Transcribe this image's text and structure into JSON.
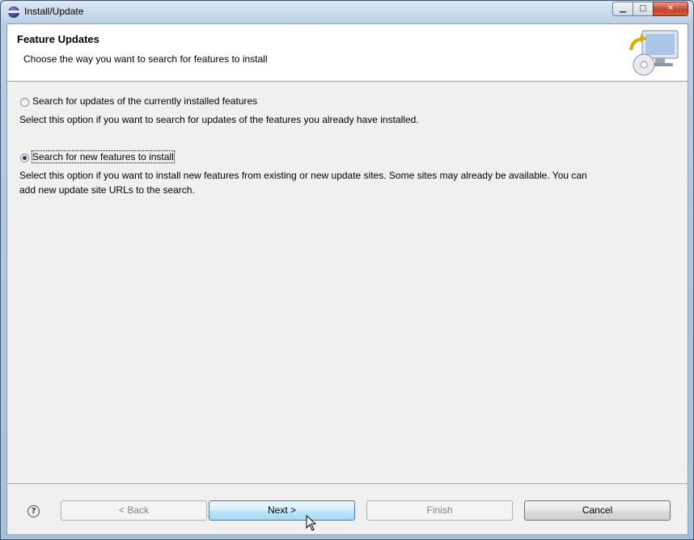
{
  "window": {
    "title": "Install/Update"
  },
  "header": {
    "title": "Feature Updates",
    "subtitle": "Choose the way you want to search for features to install"
  },
  "options": [
    {
      "label": "Search for updates of the currently installed features",
      "checked": false,
      "description": "Select this option if you want to search for updates of the features you already have installed."
    },
    {
      "label": "Search for new features to install",
      "checked": true,
      "description_line1": "Select this option if you want to install new features from existing or new update sites. Some sites may already be available. You can",
      "description_line2": "add new update site URLs to the search."
    }
  ],
  "buttons": {
    "back": "< Back",
    "next": "Next >",
    "finish": "Finish",
    "cancel": "Cancel",
    "help": "?"
  },
  "colors": {
    "header_bg": "#ffffff",
    "client_bg": "#f0f0f0",
    "default_button": "#bee6fd"
  }
}
